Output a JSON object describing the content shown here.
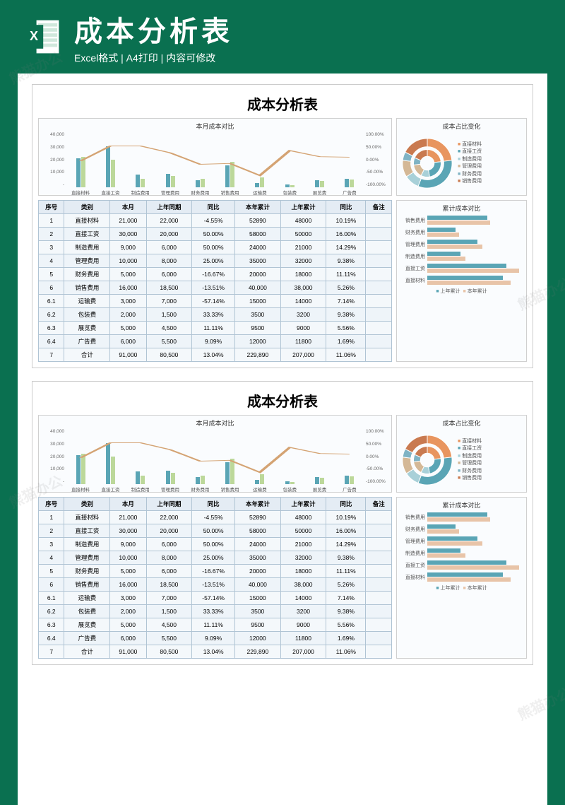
{
  "header": {
    "title": "成本分析表",
    "subtitle": "Excel格式 | A4打印 | 内容可修改"
  },
  "watermarks": [
    "熊猫办公",
    "熊猫办公",
    "熊猫办公",
    "熊猫办公"
  ],
  "sheet": {
    "title": "成本分析表",
    "combo_title": "本月成本对比",
    "donut_title": "成本占比变化",
    "hbar_title": "累计成本对比",
    "yaxis_left": [
      "40,000",
      "30,000",
      "20,000",
      "10,000",
      "-"
    ],
    "yaxis_right": [
      "100.00%",
      "50.00%",
      "0.00%",
      "-50.00%",
      "-100.00%"
    ],
    "table": {
      "headers": [
        "序号",
        "类别",
        "本月",
        "上年同期",
        "同比",
        "本年累计",
        "上年累计",
        "同比",
        "备注"
      ],
      "rows": [
        [
          "1",
          "直接材料",
          "21,000",
          "22,000",
          "-4.55%",
          "52890",
          "48000",
          "10.19%",
          ""
        ],
        [
          "2",
          "直接工资",
          "30,000",
          "20,000",
          "50.00%",
          "58000",
          "50000",
          "16.00%",
          ""
        ],
        [
          "3",
          "制造费用",
          "9,000",
          "6,000",
          "50.00%",
          "24000",
          "21000",
          "14.29%",
          ""
        ],
        [
          "4",
          "管理费用",
          "10,000",
          "8,000",
          "25.00%",
          "35000",
          "32000",
          "9.38%",
          ""
        ],
        [
          "5",
          "财务费用",
          "5,000",
          "6,000",
          "-16.67%",
          "20000",
          "18000",
          "11.11%",
          ""
        ],
        [
          "6",
          "销售费用",
          "16,000",
          "18,500",
          "-13.51%",
          "40,000",
          "38,000",
          "5.26%",
          ""
        ],
        [
          "6.1",
          "运输费",
          "3,000",
          "7,000",
          "-57.14%",
          "15000",
          "14000",
          "7.14%",
          ""
        ],
        [
          "6.2",
          "包装费",
          "2,000",
          "1,500",
          "33.33%",
          "3500",
          "3200",
          "9.38%",
          ""
        ],
        [
          "6.3",
          "展览费",
          "5,000",
          "4,500",
          "11.11%",
          "9500",
          "9000",
          "5.56%",
          ""
        ],
        [
          "6.4",
          "广告费",
          "6,000",
          "5,500",
          "9.09%",
          "12000",
          "11800",
          "1.69%",
          ""
        ],
        [
          "7",
          "合计",
          "91,000",
          "80,500",
          "13.04%",
          "229,890",
          "207,000",
          "11.06%",
          ""
        ]
      ]
    },
    "donut_legend": [
      "直接材料",
      "直接工资",
      "制造费用",
      "管理费用",
      "财务费用",
      "销售费用"
    ],
    "hbar_legend": [
      "上年累计",
      "本年累计"
    ]
  },
  "chart_data": [
    {
      "type": "bar",
      "title": "本月成本对比",
      "categories": [
        "直接材料",
        "直接工资",
        "制造费用",
        "管理费用",
        "财务费用",
        "销售费用",
        "运输费",
        "包装费",
        "展览费",
        "广告费"
      ],
      "series": [
        {
          "name": "本月",
          "values": [
            21000,
            30000,
            9000,
            10000,
            5000,
            16000,
            3000,
            2000,
            5000,
            6000
          ]
        },
        {
          "name": "上年同期",
          "values": [
            22000,
            20000,
            6000,
            8000,
            6000,
            18500,
            7000,
            1500,
            4500,
            5500
          ]
        }
      ],
      "line_series": {
        "name": "同比",
        "values": [
          -4.55,
          50.0,
          50.0,
          25.0,
          -16.67,
          -13.51,
          -57.14,
          33.33,
          11.11,
          9.09
        ]
      },
      "ylim_left": [
        0,
        40000
      ],
      "ylim_right": [
        -100,
        100
      ]
    },
    {
      "type": "pie",
      "title": "成本占比变化",
      "categories": [
        "直接材料",
        "直接工资",
        "制造费用",
        "管理费用",
        "财务费用",
        "销售费用"
      ],
      "values": [
        21000,
        30000,
        9000,
        10000,
        5000,
        16000
      ]
    },
    {
      "type": "bar",
      "title": "累计成本对比",
      "orientation": "horizontal",
      "categories": [
        "销售费用",
        "财务费用",
        "管理费用",
        "制造费用",
        "直接工资",
        "直接材料"
      ],
      "series": [
        {
          "name": "上年累计",
          "values": [
            38000,
            18000,
            32000,
            21000,
            50000,
            48000
          ]
        },
        {
          "name": "本年累计",
          "values": [
            40000,
            20000,
            35000,
            24000,
            58000,
            52890
          ]
        }
      ]
    }
  ]
}
